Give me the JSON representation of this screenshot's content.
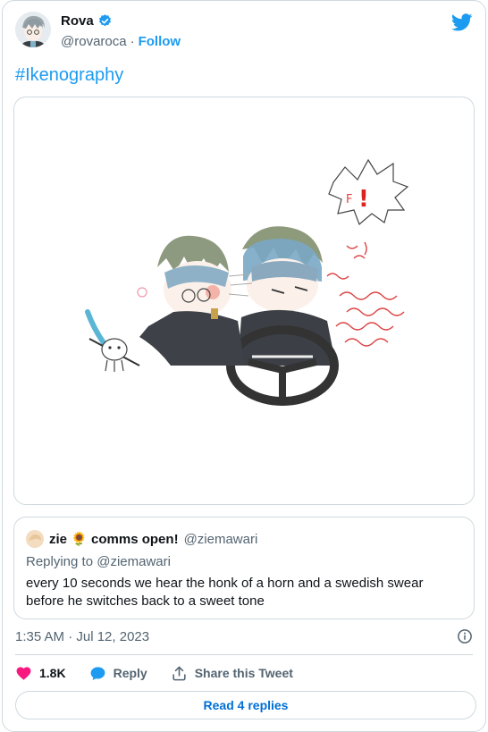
{
  "author": {
    "name": "Rova",
    "handle": "@rovaroca",
    "separator": "·",
    "follow_label": "Follow"
  },
  "tweet": {
    "hashtag": "#Ikenography",
    "timestamp": "1:35 AM · Jul 12, 2023"
  },
  "media": {
    "sfx_letter": "F",
    "sfx_mark": "!"
  },
  "quote": {
    "name_part1": "zie",
    "emoji": "🌻",
    "name_part2": "comms open!",
    "handle": "@ziemawari",
    "replying_to": "Replying to @ziemawari",
    "text": "every 10 seconds we hear the honk of a horn and a swedish swear before he switches back to a sweet tone"
  },
  "actions": {
    "like_count": "1.8K",
    "reply_label": "Reply",
    "share_label": "Share this Tweet"
  },
  "footer": {
    "read_replies_label": "Read 4 replies"
  },
  "colors": {
    "accent": "#1d9bf0",
    "like": "#f91880",
    "text_secondary": "#536471"
  }
}
